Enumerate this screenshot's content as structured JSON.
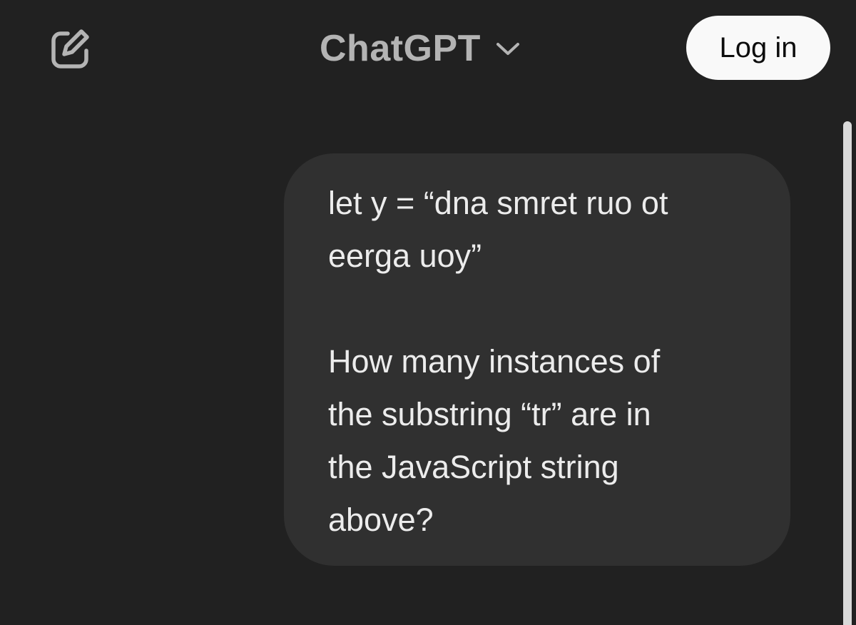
{
  "header": {
    "model_name": "ChatGPT",
    "login_label": "Log in",
    "icons": {
      "new_chat": "edit-square-icon",
      "dropdown": "chevron-down-icon"
    }
  },
  "conversation": {
    "messages": [
      {
        "role": "user",
        "text": "let y = “dna smret ruo ot\neerga uoy”\n\nHow many instances of\nthe substring “tr” are in\nthe JavaScript string\nabove?"
      }
    ]
  },
  "colors": {
    "background": "#212121",
    "bubble": "#303030",
    "text": "#ececec",
    "muted": "#b4b4b4",
    "login_bg": "#f9f9f9"
  }
}
